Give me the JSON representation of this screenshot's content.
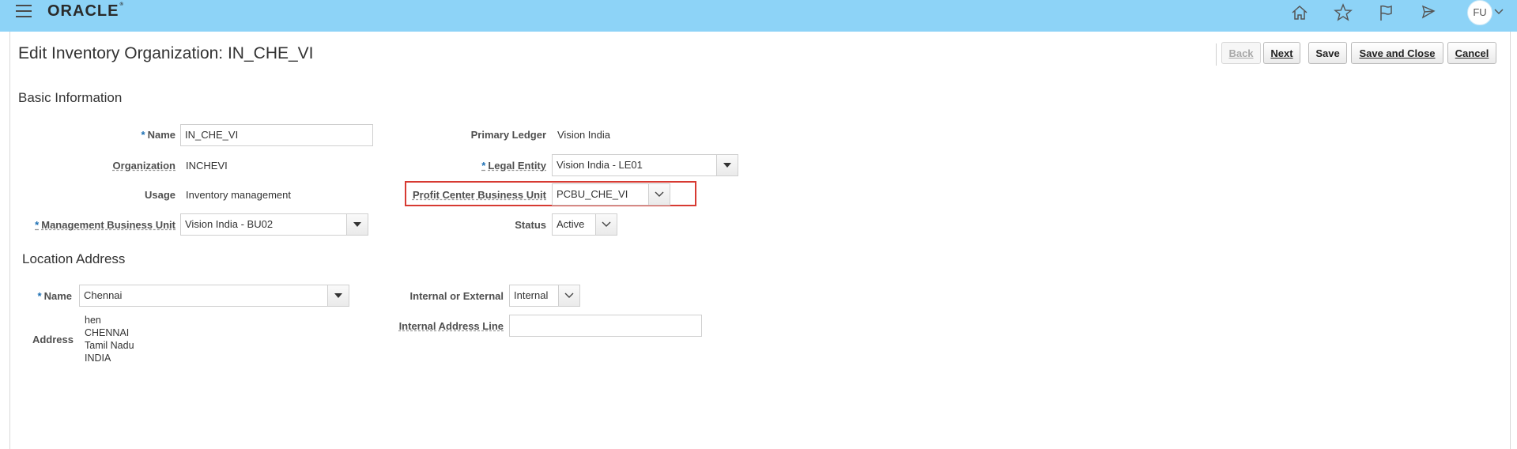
{
  "header": {
    "logo": "ORACLE",
    "avatar_initials": "FU",
    "icons": [
      "menu-icon",
      "home-icon",
      "star-icon",
      "flag-icon",
      "notifications-icon"
    ]
  },
  "page": {
    "title": "Edit Inventory Organization: IN_CHE_VI"
  },
  "toolbar": {
    "back": "Back",
    "next": "Next",
    "save": "Save",
    "save_close": "Save and Close",
    "cancel": "Cancel"
  },
  "basic": {
    "title": "Basic Information",
    "name_label": "Name",
    "name_value": "IN_CHE_VI",
    "org_label": "Organization",
    "org_value": "INCHEVI",
    "usage_label": "Usage",
    "usage_value": "Inventory management",
    "mbu_label": "Management Business Unit",
    "mbu_value": "Vision India - BU02",
    "ledger_label": "Primary Ledger",
    "ledger_value": "Vision India",
    "legal_label": "Legal Entity",
    "legal_value": "Vision India - LE01",
    "pcbu_label": "Profit Center Business Unit",
    "pcbu_value": "PCBU_CHE_VI",
    "status_label": "Status",
    "status_value": "Active"
  },
  "location": {
    "title": "Location Address",
    "name_label": "Name",
    "name_value": "Chennai",
    "address_label": "Address",
    "address_lines": [
      "hen",
      "CHENNAI",
      "Tamil Nadu",
      "INDIA"
    ],
    "int_ext_label": "Internal or External",
    "int_ext_value": "Internal",
    "int_addr_label": "Internal Address Line",
    "int_addr_value": ""
  },
  "colors": {
    "header_bg": "#8dd3f7",
    "required": "#1c6fb3",
    "highlight": "#d73a32"
  }
}
